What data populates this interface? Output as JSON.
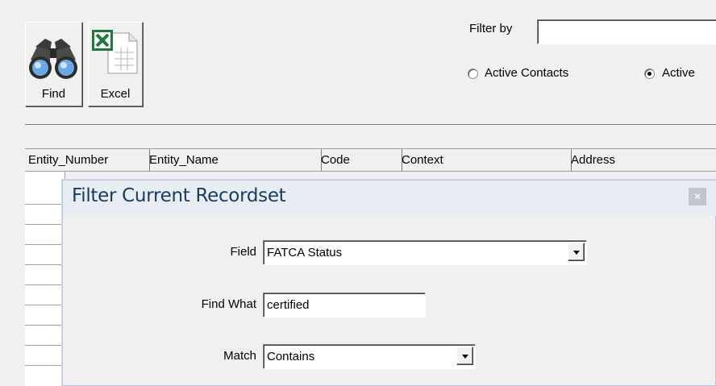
{
  "toolbar": {
    "find_label": "Find",
    "excel_label": "Excel"
  },
  "filter": {
    "label": "Filter by",
    "value": "",
    "radio_active_contacts": "Active Contacts",
    "radio_active_partial": "Active",
    "selected": "Active"
  },
  "grid": {
    "columns": [
      "Entity_Number",
      "Entity_Name",
      "Code",
      "Context",
      "Address"
    ]
  },
  "dialog": {
    "title": "Filter Current Recordset",
    "close_glyph": "×",
    "field_label": "Field",
    "field_value": "FATCA Status",
    "findwhat_label": "Find What",
    "findwhat_value": "certified",
    "match_label": "Match",
    "match_value": "Contains"
  },
  "icons": [
    "binoculars-icon",
    "excel-icon",
    "chevron-down-icon",
    "close-icon"
  ],
  "colors": {
    "window_bg": "#f0f0f0",
    "dialog_title_text": "#1a3a5e",
    "excel_green": "#1d7a3a"
  }
}
